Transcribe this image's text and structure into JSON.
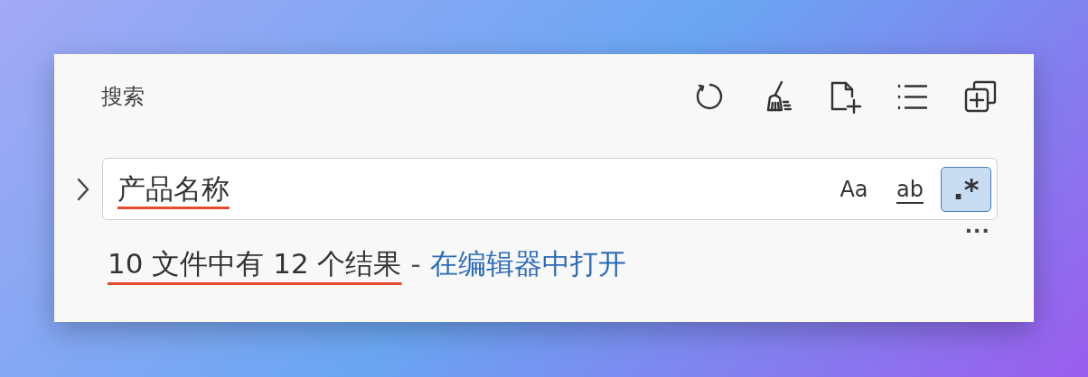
{
  "panel": {
    "title": "搜索",
    "actions": [
      {
        "kind": "refresh"
      },
      {
        "kind": "clear"
      },
      {
        "kind": "new-file"
      },
      {
        "kind": "list"
      },
      {
        "kind": "collapse"
      }
    ]
  },
  "search": {
    "expanded": false,
    "value": "产品名称",
    "highlighted": true,
    "options": [
      {
        "label": "Aa",
        "kind": "case",
        "selected": false
      },
      {
        "label": "ab",
        "kind": "word",
        "selected": false
      },
      {
        "label": ".*",
        "kind": "regex",
        "selected": true
      }
    ],
    "more": "···"
  },
  "results": {
    "summary": "10 文件中有 12 个结果",
    "highlighted": true,
    "separator": "-",
    "link": "在编辑器中打开"
  }
}
